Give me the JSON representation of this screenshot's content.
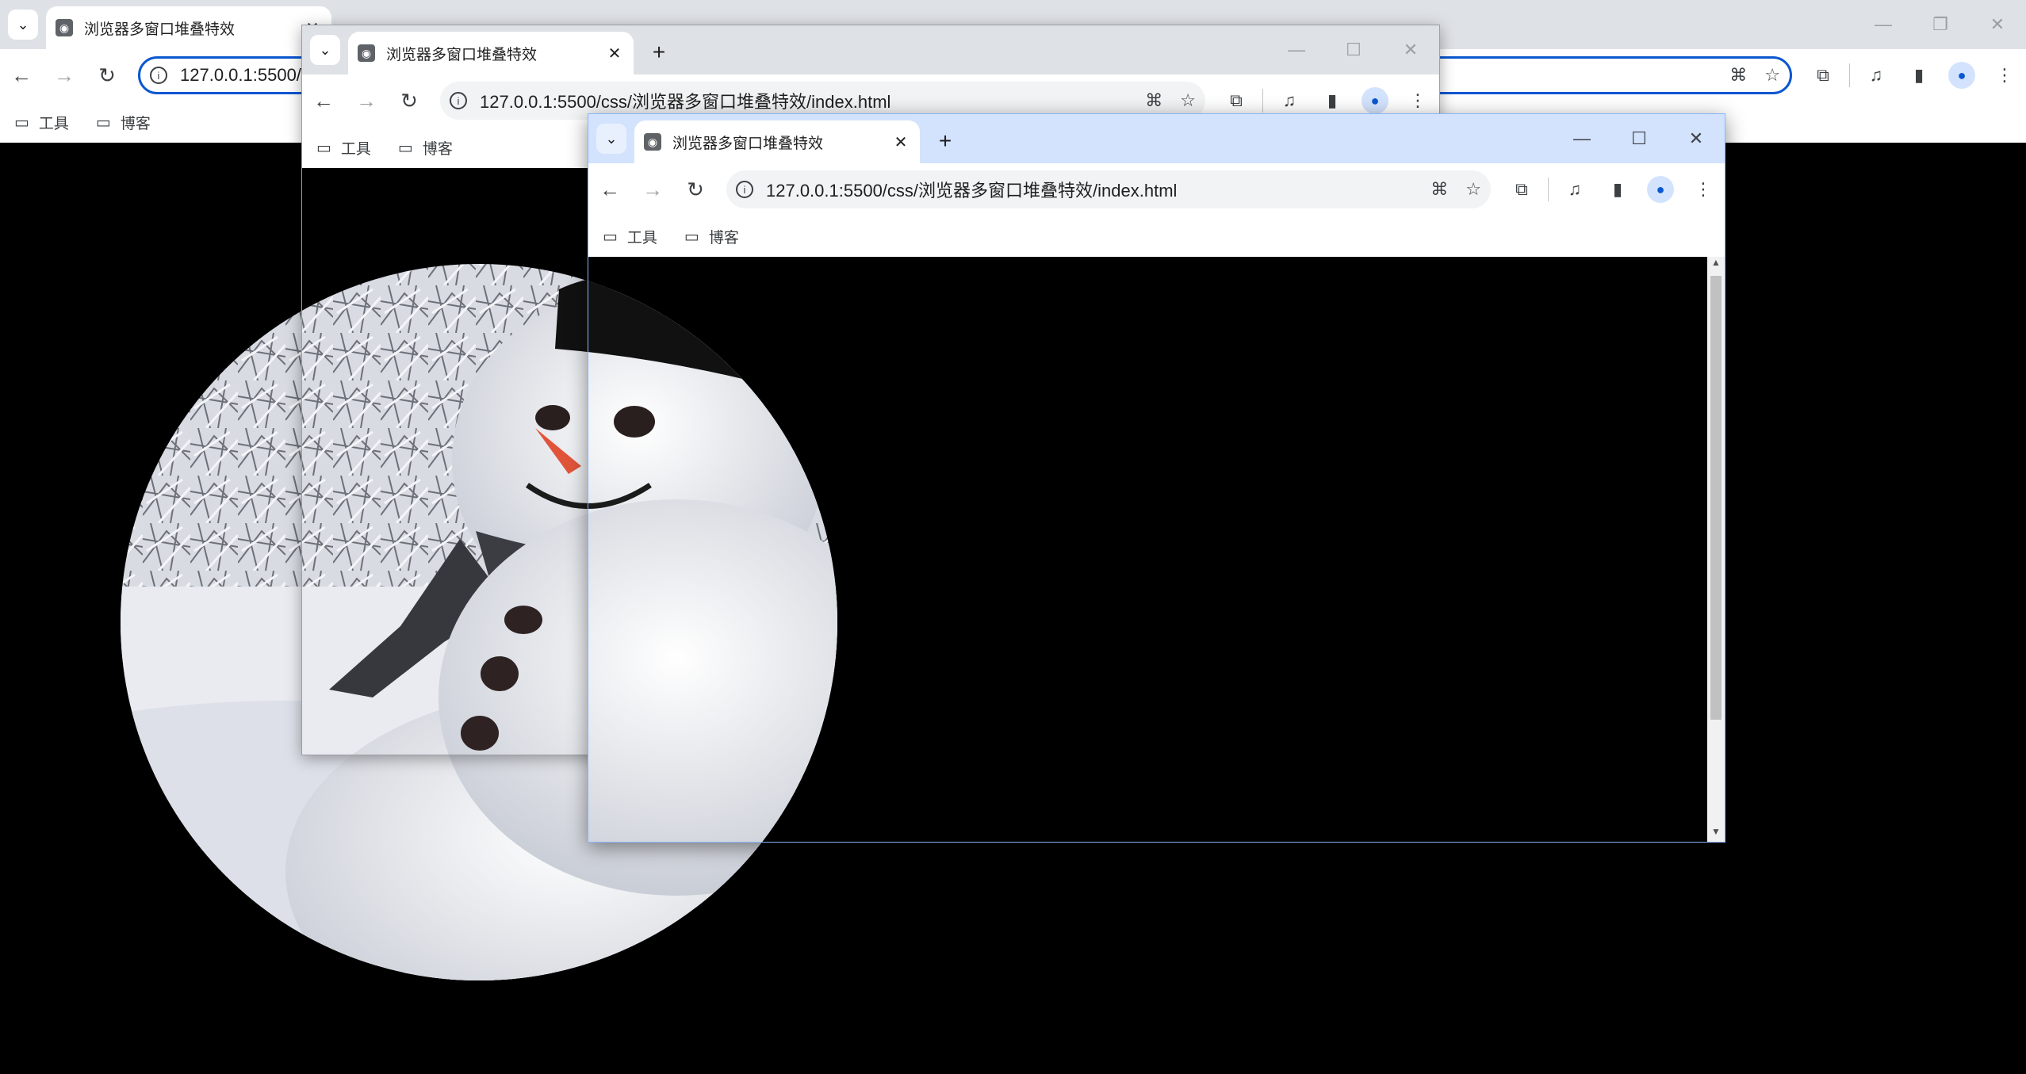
{
  "tab_title": "浏览器多窗口堆叠特效",
  "url": "127.0.0.1:5500/css/浏览器多窗口堆叠特效/index.html",
  "back_url_visible": "127.0.0.1:5500/",
  "bookmarks": [
    {
      "label": "工具"
    },
    {
      "label": "博客"
    }
  ],
  "icons": {
    "tab_menu": "chevron-down-icon",
    "favicon": "broadcast-icon",
    "close": "close-icon",
    "new_tab": "plus-icon",
    "back": "arrow-left-icon",
    "forward": "arrow-right-icon",
    "reload": "reload-icon",
    "site_info": "info-icon",
    "translate": "translate-icon",
    "bookmark": "star-icon",
    "extensions": "puzzle-icon",
    "media": "media-control-icon",
    "side_panel": "side-panel-icon",
    "profile": "profile-icon",
    "menu": "kebab-menu-icon",
    "folder": "folder-icon"
  },
  "colors": {
    "page_background": "#000000",
    "active_frame": "#d3e3fd",
    "inactive_frame": "#dee1e6",
    "accent": "#0b57d0"
  }
}
